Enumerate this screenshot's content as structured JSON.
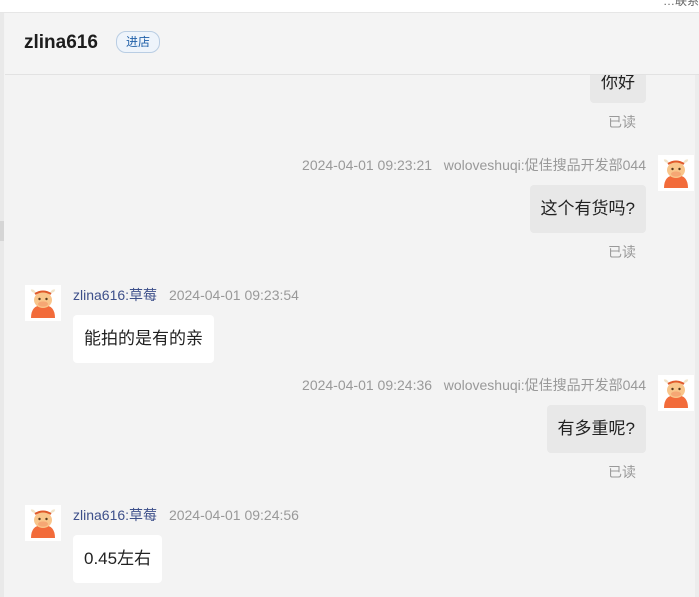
{
  "topbar": {
    "clipped_text": "…联系"
  },
  "header": {
    "shop_name": "zlina616",
    "enter_shop_label": "进店"
  },
  "messages": [
    {
      "direction": "out",
      "text": "你好",
      "status": "已读"
    },
    {
      "direction": "out",
      "timestamp": "2024-04-01 09:23:21",
      "sender": "woloveshuqi:促佳搜品开发部044",
      "text": "这个有货吗?",
      "status": "已读"
    },
    {
      "direction": "in",
      "sender": "zlina616:草莓",
      "timestamp": "2024-04-01 09:23:54",
      "text": "能拍的是有的亲"
    },
    {
      "direction": "out",
      "timestamp": "2024-04-01 09:24:36",
      "sender": "woloveshuqi:促佳搜品开发部044",
      "text": "有多重呢?",
      "status": "已读"
    },
    {
      "direction": "in",
      "sender": "zlina616:草莓",
      "timestamp": "2024-04-01 09:24:56",
      "text": "0.45左右"
    }
  ],
  "icons": {
    "user_avatar": "cartoon-cow-avatar-icon",
    "shop_avatar": "cartoon-cow-avatar-icon"
  },
  "colors": {
    "avatar_body": "#f26b3a",
    "avatar_face": "#f9c58a",
    "sender_in": "#3d4f8a",
    "enter_shop": "#1f5fa8"
  }
}
